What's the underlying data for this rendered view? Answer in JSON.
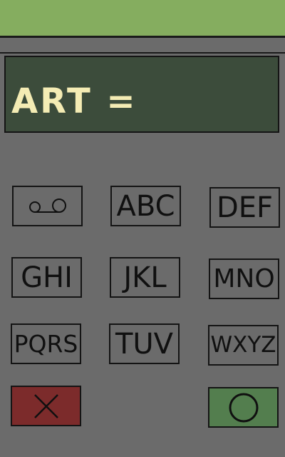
{
  "display": {
    "text": "ART ="
  },
  "keypad": {
    "voicemail_icon": "voicemail-icon",
    "keys": [
      "ABC",
      "DEF",
      "GHI",
      "JKL",
      "MNO",
      "PQRS",
      "TUV",
      "WXYZ"
    ],
    "cancel_icon": "close-icon",
    "confirm_icon": "circle-icon"
  },
  "colors": {
    "top_bar": "#85ad5f",
    "background": "#6b6b6b",
    "display_bg": "#3c4c3b",
    "display_text": "#f4ecb4",
    "cancel_key": "#7c2b2b",
    "confirm_key": "#537e4e"
  }
}
